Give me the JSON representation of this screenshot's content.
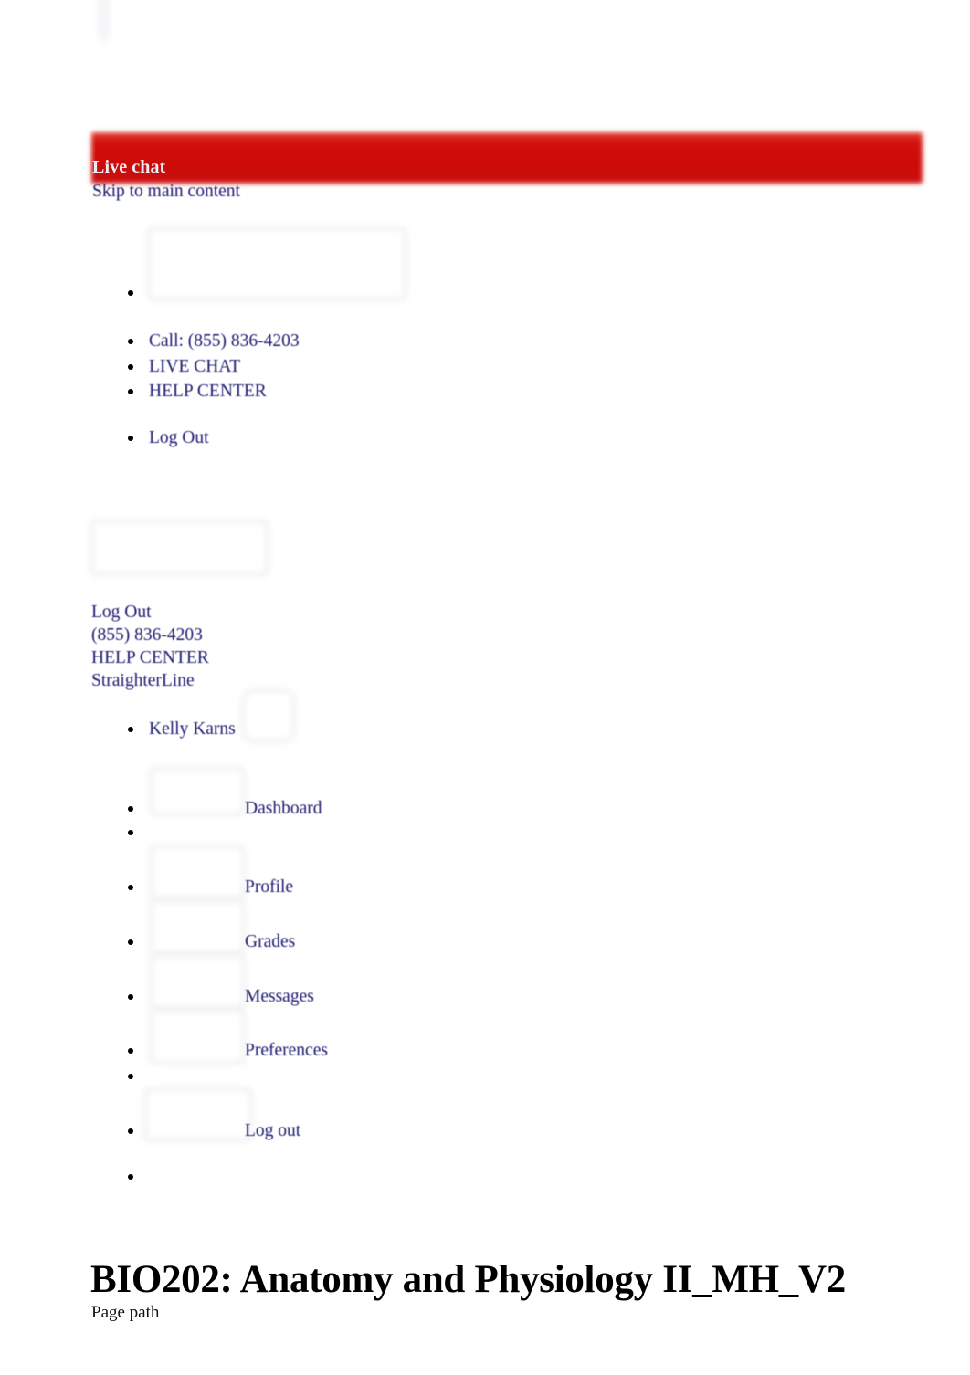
{
  "page": {
    "course_title": "BIO202: Anatomy and Physiology II_MH_V2",
    "page_path_label": "Page path"
  },
  "livechat": {
    "banner_label": "Live chat",
    "banner_color": "#cc0a06",
    "text_color": "#e9eef5"
  },
  "accessibility": {
    "skip_link": "Skip to main content"
  },
  "link_color": "#191970",
  "top_nav": {
    "items": [
      {
        "label": "",
        "icon": "site-logo-placeholder"
      },
      {
        "label": "Call: (855) 836-4203",
        "icon": "phone-icon"
      },
      {
        "label": "LIVE CHAT",
        "icon": "chat-icon"
      },
      {
        "label": "HELP CENTER",
        "icon": "help-icon"
      },
      {
        "label": "Log Out",
        "icon": "logout-icon"
      }
    ]
  },
  "secondary_nav": {
    "logo_placeholder": "straighterline-logo",
    "links": [
      "Log Out",
      "(855) 836-4203",
      "HELP CENTER",
      "StraighterLine"
    ]
  },
  "user_menu": {
    "user_name": "Kelly Karns",
    "avatar": "user-avatar-placeholder",
    "items": [
      {
        "label": "Dashboard",
        "icon": "dashboard-icon"
      },
      {
        "label": "",
        "icon": "divider"
      },
      {
        "label": "Profile",
        "icon": "profile-icon"
      },
      {
        "label": "Grades",
        "icon": "grades-icon"
      },
      {
        "label": "Messages",
        "icon": "messages-icon"
      },
      {
        "label": "Preferences",
        "icon": "preferences-icon"
      },
      {
        "label": "",
        "icon": "divider"
      },
      {
        "label": "Log out",
        "icon": "logout-icon"
      },
      {
        "label": "",
        "icon": "divider"
      }
    ]
  }
}
